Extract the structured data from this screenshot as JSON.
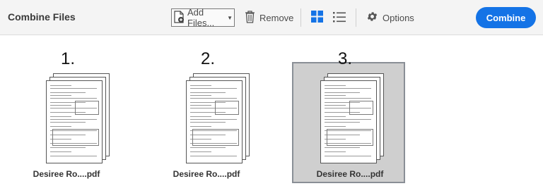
{
  "header": {
    "title": "Combine Files",
    "add_files_label": "Add Files...",
    "remove_label": "Remove",
    "options_label": "Options",
    "combine_label": "Combine"
  },
  "icons": {
    "add_files": "document-plus-icon",
    "remove": "trash-icon",
    "grid_view": "grid-view-icon",
    "list_view": "list-view-icon",
    "options": "gear-icon"
  },
  "colors": {
    "accent": "#1473e6",
    "grid_icon": "#1473e6",
    "selected_tile": "#cfcfcf"
  },
  "files": [
    {
      "number": "1.",
      "name": "Desiree Ro....pdf",
      "selected": false
    },
    {
      "number": "2.",
      "name": "Desiree Ro....pdf",
      "selected": false
    },
    {
      "number": "3.",
      "name": "Desiree Ro....pdf",
      "selected": true
    }
  ]
}
